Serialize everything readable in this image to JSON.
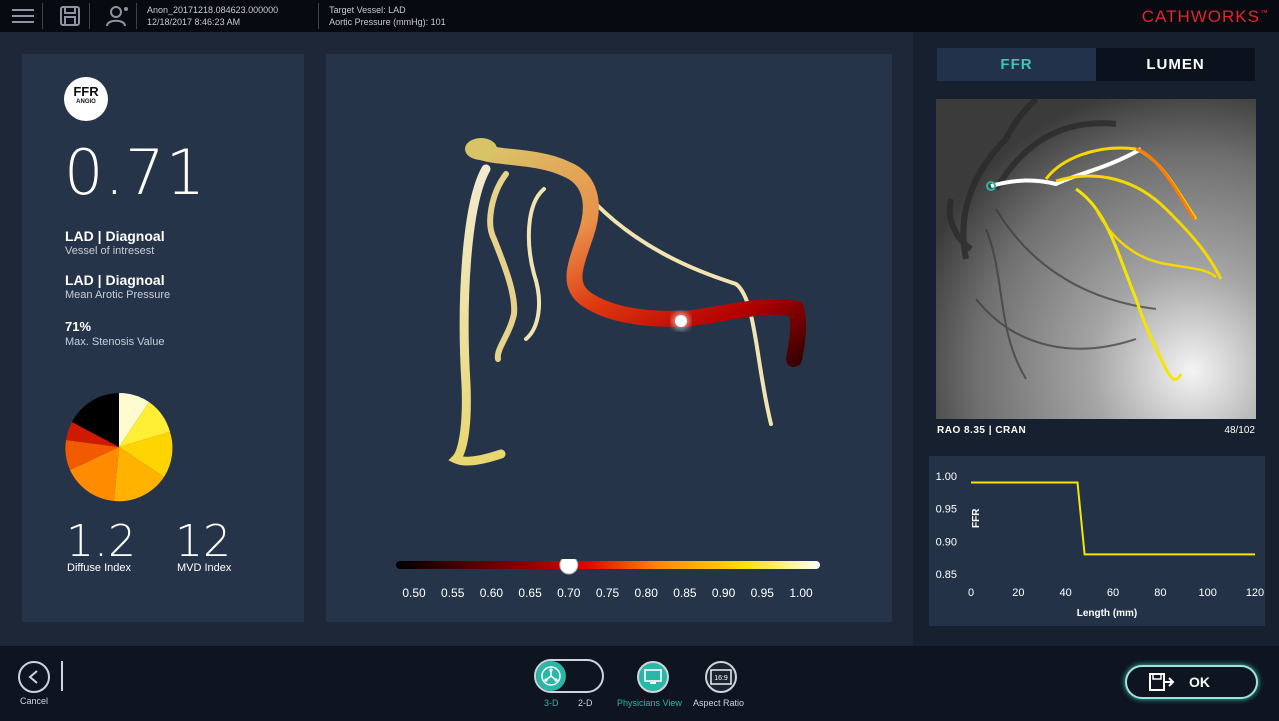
{
  "topbar": {
    "file_name": "Anon_20171218.084623.000000",
    "file_date": "12/18/2017 8:46:23 AM",
    "target_vessel": "Target Vessel: LAD",
    "aortic_pressure": "Aortic Pressure (mmHg): 101",
    "brand": "CATHWORKS",
    "icons": [
      "menu-icon",
      "save-icon",
      "user-icon"
    ]
  },
  "left_panel": {
    "badge_main": "FFR",
    "badge_sub": "ANGIO",
    "ffr_value": "0.71",
    "vessel_title": "LAD | Diagnoal",
    "vessel_sub": "Vessel of intresest",
    "pressure_title": "LAD | Diagnoal",
    "pressure_sub": "Mean Arotic Pressure",
    "stenosis_value": "71%",
    "stenosis_label": "Max. Stenosis Value",
    "diffuse_value": "1.2",
    "diffuse_label": "Diffuse Index",
    "mvd_value": "12",
    "mvd_label": "MVD Index",
    "pie_colors": [
      "#fffbd0",
      "#ffee33",
      "#ffd400",
      "#ffb300",
      "#ff8c00",
      "#f25a00",
      "#d01a00",
      "#000000"
    ]
  },
  "scale": {
    "ticks": [
      "0.50",
      "0.55",
      "0.60",
      "0.65",
      "0.70",
      "0.75",
      "0.80",
      "0.85",
      "0.90",
      "0.95",
      "1.00"
    ],
    "current": 0.7
  },
  "right_panel": {
    "tabs": [
      {
        "label": "FFR"
      },
      {
        "label": "LUMEN"
      }
    ],
    "angio_caption": "RAO 8.35 | CRAN",
    "frame": "48/102"
  },
  "chart_data": {
    "type": "line",
    "title": "",
    "xlabel": "Length (mm)",
    "ylabel": "FFR",
    "xlim": [
      0,
      120
    ],
    "ylim": [
      0.85,
      1.0
    ],
    "x_ticks": [
      "0",
      "20",
      "40",
      "60",
      "80",
      "100",
      "120"
    ],
    "y_ticks": [
      "1.00",
      "0.95",
      "0.90",
      "0.85"
    ],
    "series": [
      {
        "x": [
          0,
          45,
          48,
          120
        ],
        "values": [
          0.99,
          0.99,
          0.88,
          0.88
        ],
        "color": "#f5e500"
      }
    ],
    "grid": false
  },
  "bottom": {
    "cancel_label": "Cancel",
    "toggle_3d": "3-D",
    "toggle_2d": "2-D",
    "physicians_view": "Physicians View",
    "aspect_ratio": "Aspect Ratio",
    "aspect_icon_text": "16:9",
    "ok_label": "OK"
  }
}
